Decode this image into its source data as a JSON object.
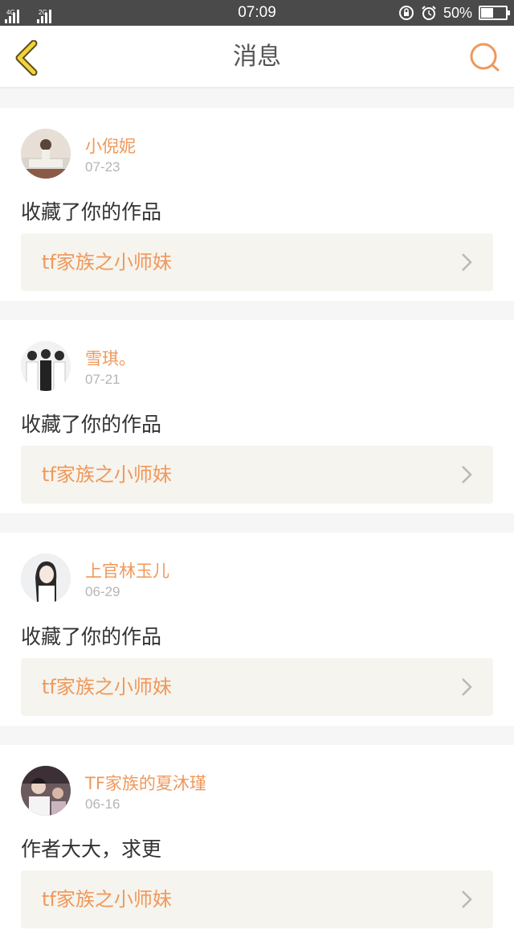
{
  "status_bar": {
    "sim1": "4G",
    "sim2": "2G",
    "time": "07:09",
    "battery": "50%",
    "battery_level": 0.5
  },
  "header": {
    "title": "消息"
  },
  "messages": [
    {
      "user": "小倪妮",
      "date": "07-23",
      "action": "收藏了你的作品",
      "work": "tf家族之小师妹"
    },
    {
      "user": "雪琪。",
      "date": "07-21",
      "action": "收藏了你的作品",
      "work": "tf家族之小师妹"
    },
    {
      "user": "上官林玉儿",
      "date": "06-29",
      "action": "收藏了你的作品",
      "work": "tf家族之小师妹"
    },
    {
      "user": "TF家族的夏沐瑾",
      "date": "06-16",
      "action": "作者大大，求更",
      "work": "tf家族之小师妹"
    }
  ],
  "colors": {
    "accent": "#f0985a",
    "back_icon": "#f3d23a",
    "status_bar_bg": "#4a4a4a"
  },
  "icons": {
    "back": "chevron-left-icon",
    "search": "search-icon",
    "work_arrow": "chevron-right-icon"
  }
}
